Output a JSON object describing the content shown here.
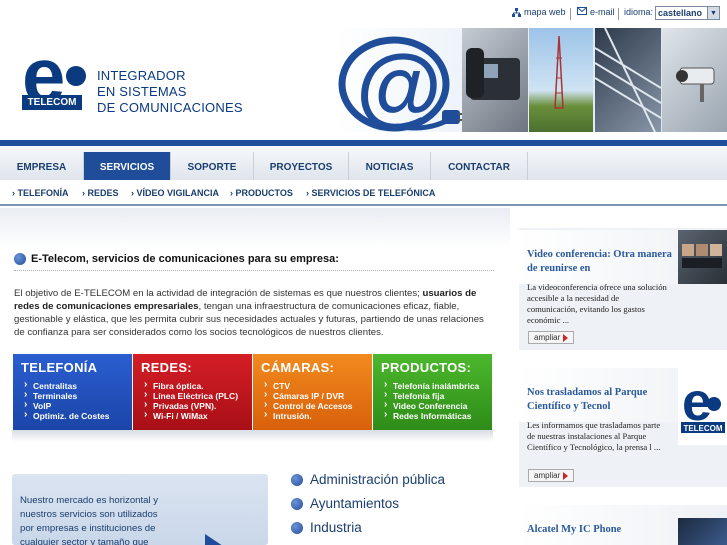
{
  "topbar": {
    "mapa_web": "mapa web",
    "email": "e-mail",
    "idioma_label": "idioma:",
    "idioma_value": "castellano"
  },
  "header": {
    "logo_letter": "e",
    "logo_sub": "TELECOM",
    "tagline": [
      "INTEGRADOR",
      "EN SISTEMAS",
      "DE COMUNICACIONES"
    ]
  },
  "nav": {
    "items": [
      {
        "label": "EMPRESA",
        "active": false
      },
      {
        "label": "SERVICIOS",
        "active": true
      },
      {
        "label": "SOPORTE",
        "active": false
      },
      {
        "label": "PROYECTOS",
        "active": false
      },
      {
        "label": "NOTICIAS",
        "active": false
      },
      {
        "label": "CONTACTAR",
        "active": false
      }
    ]
  },
  "subnav": {
    "items": [
      "› TELEFONÍA",
      "› REDES",
      "› VÍDEO VIGILANCIA",
      "› PRODUCTOS",
      "› SERVICIOS DE TELEFÓNICA"
    ]
  },
  "main": {
    "title": "E-Telecom, servicios de comunicaciones para su empresa:",
    "intro_a": "El objetivo de E-TELECOM en la actividad de integración de sistemas es que nuestros clientes; ",
    "intro_b": "usuarios de redes de comunicaciones empresariales",
    "intro_c": ", tengan una infraestructura de comunicaciones eficaz, fiable, gestionable y elástica, que les permita cubrir sus necesidades actuales y futuras, partiendo de unas relaciones de confianza para ser considerados como los socios tecnológicos de nuestros clientes."
  },
  "boxes": [
    {
      "title": "TELEFONÍA",
      "color": "#1f4fb8",
      "items": [
        "Centralitas",
        "Terminales",
        "VoIP",
        "Optimiz. de Costes"
      ]
    },
    {
      "title": "REDES:",
      "color": "#c0141c",
      "items": [
        "Fibra óptica.",
        "Línea Eléctrica (PLC)",
        "Privadas (VPN).",
        "Wi-Fi / WiMax"
      ]
    },
    {
      "title": "CÁMARAS:",
      "color": "#e8740f",
      "items": [
        "CTV",
        "Cámaras IP / DVR",
        "Control de Accesos",
        "Intrusión."
      ]
    },
    {
      "title": "PRODUCTOS:",
      "color": "#3aa020",
      "items": [
        "Telefonía inalámbrica",
        "Telefonía fija",
        "Video Conferencia",
        "Redes Informáticas"
      ]
    }
  ],
  "info": {
    "text": "Nuestro mercado es horizontal y nuestros servicios son utilizados por empresas e instituciones de cualquier sector y tamaño que"
  },
  "sectors": [
    "Administración pública",
    "Ayuntamientos",
    "Industria"
  ],
  "news": [
    {
      "title": "Video conferencia: Otra manera de reunirse en",
      "body": "La videoconferencia ofrece una solución accesible a la necesidad de comunicación, evitando los gastos económic ...",
      "button": "ampliar"
    },
    {
      "title": "Nos trasladamos al Parque Científico y Tecnol",
      "body": "Les informamos que trasladamos parte de nuestras instalaciones al Parque Científico y Tecnológico, la prensa l ...",
      "button": "ampliar"
    },
    {
      "title": "Alcatel My IC Phone",
      "body": "",
      "button": ""
    }
  ],
  "colors": {
    "brand_blue": "#0a3a80",
    "nav_blue": "#1f4d9a",
    "news_title": "#2a5a9a"
  }
}
